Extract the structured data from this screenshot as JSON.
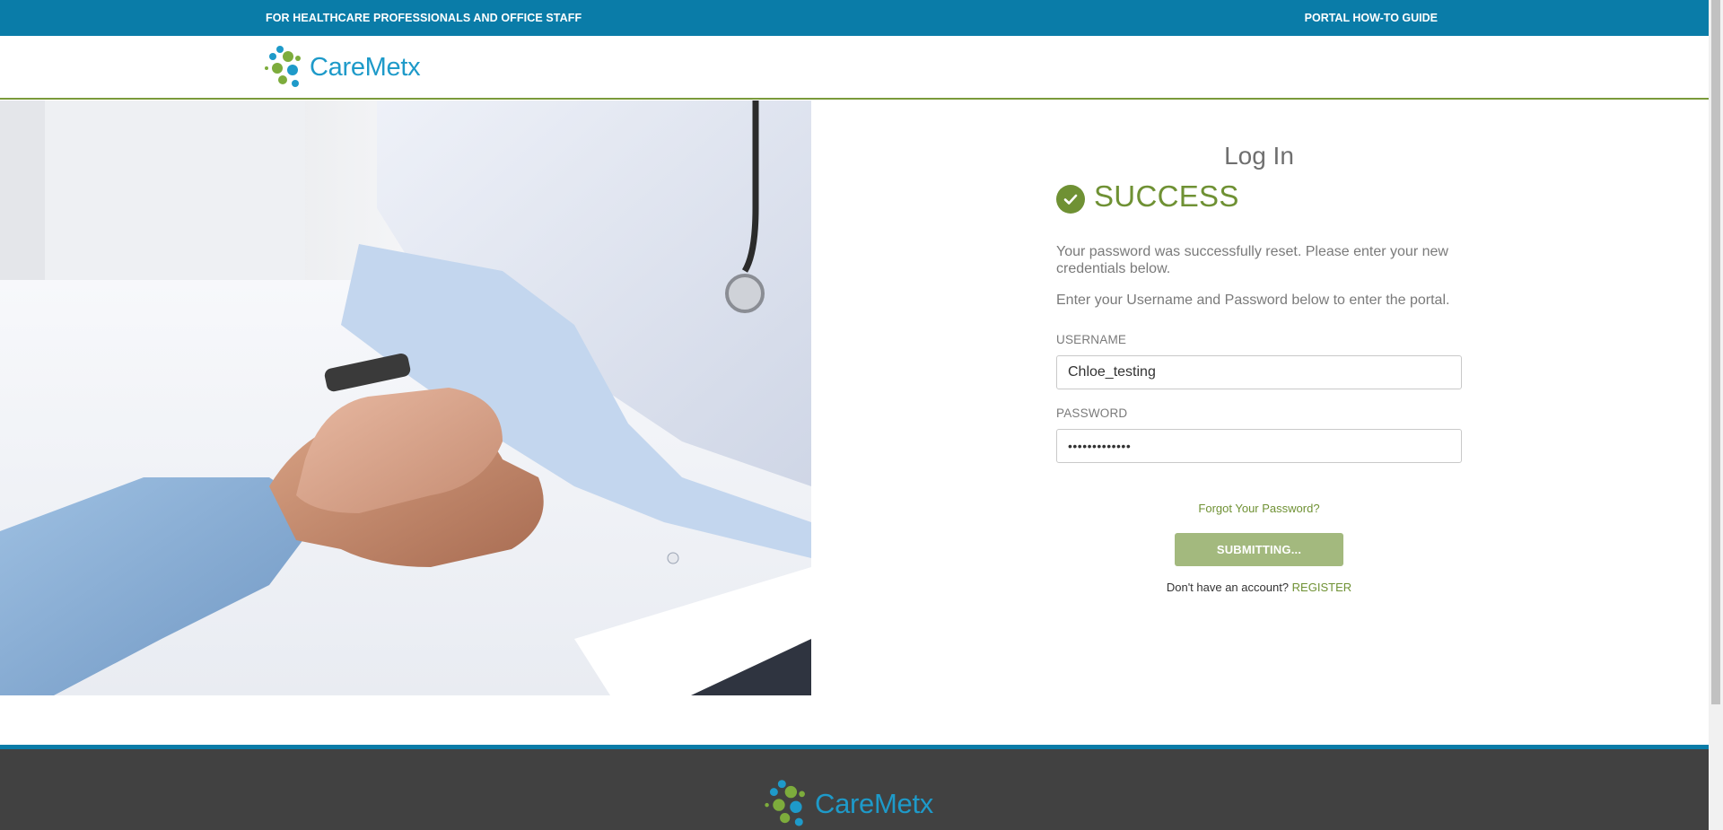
{
  "topbar": {
    "left_text": "FOR HEALTHCARE PROFESSIONALS AND OFFICE STAFF",
    "right_link": "PORTAL HOW-TO GUIDE"
  },
  "brand": {
    "name": "CareMetx",
    "colors": {
      "blue": "#1e9ac9",
      "green": "#7dac3c",
      "topbar": "#0a7ca8",
      "accent": "#6f9134"
    }
  },
  "login": {
    "title": "Log In",
    "status_label": "SUCCESS",
    "status_icon": "check-circle-icon",
    "message_reset": "Your password was successfully reset. Please enter your new credentials below.",
    "message_enter": "Enter your Username and Password below to enter the portal.",
    "username_label": "USERNAME",
    "username_value": "Chloe_testing",
    "password_label": "PASSWORD",
    "password_value": "•••••••••••••",
    "forgot_link": "Forgot Your Password?",
    "submit_label": "SUBMITTING...",
    "no_account_text": "Don't have an account?",
    "register_link": "REGISTER"
  },
  "hero": {
    "image": "doctor holding patient's hands at desk"
  }
}
